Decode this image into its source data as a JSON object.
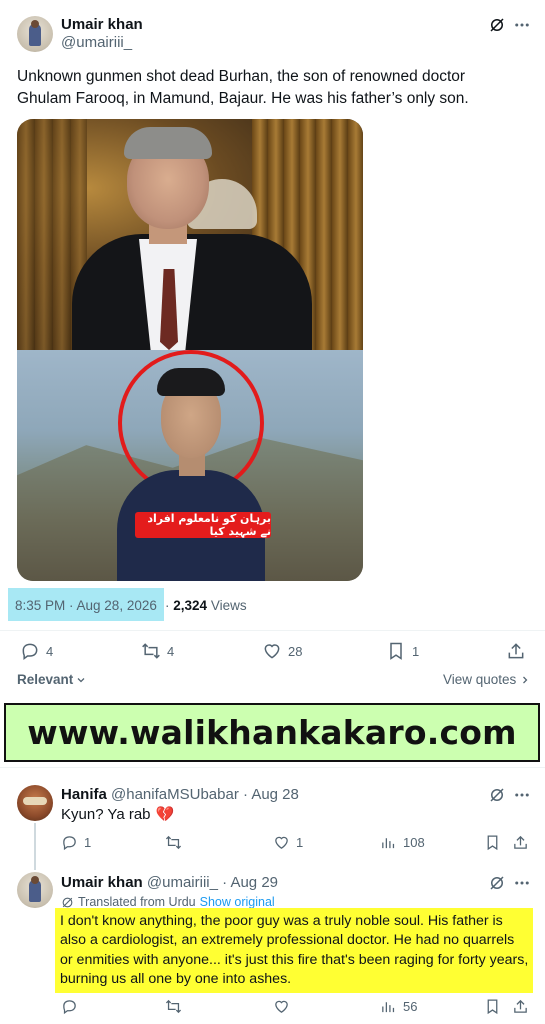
{
  "post": {
    "author_name": "Umair khan",
    "author_handle": "@umairiii_",
    "text": "Unknown gunmen shot dead Burhan, the son of renowned doctor Ghulam Farooq, in Mamund, Bajaur. He was his father’s only son.",
    "image_caption_urdu": "برہان کو نامعلوم افراد نے شہید کیا",
    "timestamp": "8:35 PM · Aug 28, 2026",
    "views_count": "2,324",
    "views_label": "Views",
    "replies": "4",
    "reposts": "4",
    "likes": "28",
    "bookmarks": "1"
  },
  "sort": {
    "label": "Relevant",
    "view_quotes": "View quotes"
  },
  "banner": {
    "text": "www.walikhankakaro.com",
    "background": "#ccffb0"
  },
  "replies": [
    {
      "author_name": "Hanifa",
      "author_handle": "@hanifaMSUbabar",
      "date": "· Aug 28",
      "text": "Kyun? Ya rab",
      "emoji": "💔",
      "replies": "1",
      "likes": "1",
      "views": "108"
    },
    {
      "author_name": "Umair khan",
      "author_handle": "@umairiii_",
      "date": "· Aug 29",
      "translated_label": "Translated from Urdu",
      "show_original": "Show original",
      "text": "I don't know anything, the poor guy was a truly noble soul. His father is also a cardiologist, an extremely professional doctor. He had no quarrels or enmities with anyone... it's just this fire that's been raging for forty years, burning us all one by one into ashes.",
      "views": "56"
    }
  ],
  "colors": {
    "accent": "#1d9bf0",
    "muted": "#536471",
    "timestamp_highlight": "#a8e8f4",
    "reply_highlight": "#ffff33",
    "broken_heart": "#e0245e"
  },
  "icons": [
    "grok-icon",
    "more-icon",
    "reply-icon",
    "repost-icon",
    "like-icon",
    "bookmark-icon",
    "share-icon",
    "views-icon",
    "translate-icon",
    "chevron-down-icon",
    "chevron-right-icon"
  ]
}
